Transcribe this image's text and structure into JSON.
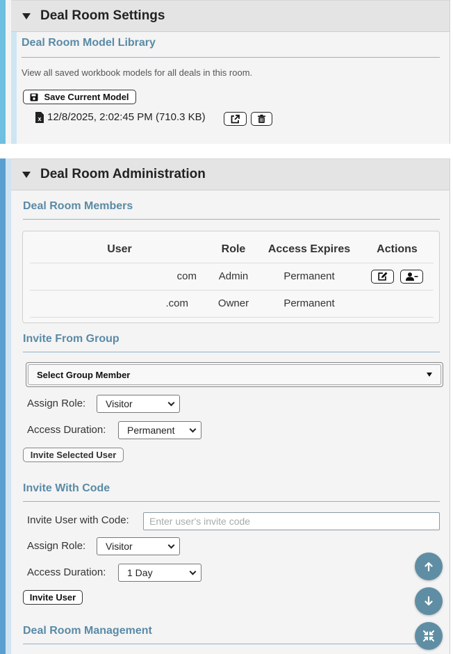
{
  "settings_panel": {
    "title": "Deal Room Settings",
    "model_library": {
      "title": "Deal Room Model Library",
      "description": "View all saved workbook models for all deals in this room.",
      "save_button": "Save Current Model",
      "models": [
        {
          "label": "12/8/2025, 2:02:45 PM (710.3 KB)",
          "icon": "excel-file-icon"
        }
      ]
    }
  },
  "admin_panel": {
    "title": "Deal Room Administration",
    "members": {
      "title": "Deal Room Members",
      "columns": [
        "User",
        "Role",
        "Access Expires",
        "Actions"
      ],
      "rows": [
        {
          "user": "com",
          "role": "Admin",
          "expires": "Permanent",
          "actions": [
            "edit-icon",
            "remove-user-icon"
          ]
        },
        {
          "user": ".com",
          "role": "Owner",
          "expires": "Permanent",
          "actions": []
        }
      ]
    },
    "invite_group": {
      "title": "Invite From Group",
      "member_select": "Select Group Member",
      "role_label": "Assign Role:",
      "role_value": "Visitor",
      "duration_label": "Access Duration:",
      "duration_value": "Permanent",
      "invite_button": "Invite Selected User"
    },
    "invite_code": {
      "title": "Invite With Code",
      "code_label": "Invite User with Code:",
      "code_placeholder": "Enter user's invite code",
      "role_label": "Assign Role:",
      "role_value": "Visitor",
      "duration_label": "Access Duration:",
      "duration_value": "1 Day",
      "invite_button": "Invite User"
    },
    "management": {
      "title": "Deal Room Management"
    }
  },
  "colors": {
    "accent_blue": "#5aa4d0",
    "section_title": "#5a8aa6",
    "fab": "#5f8ea4"
  }
}
